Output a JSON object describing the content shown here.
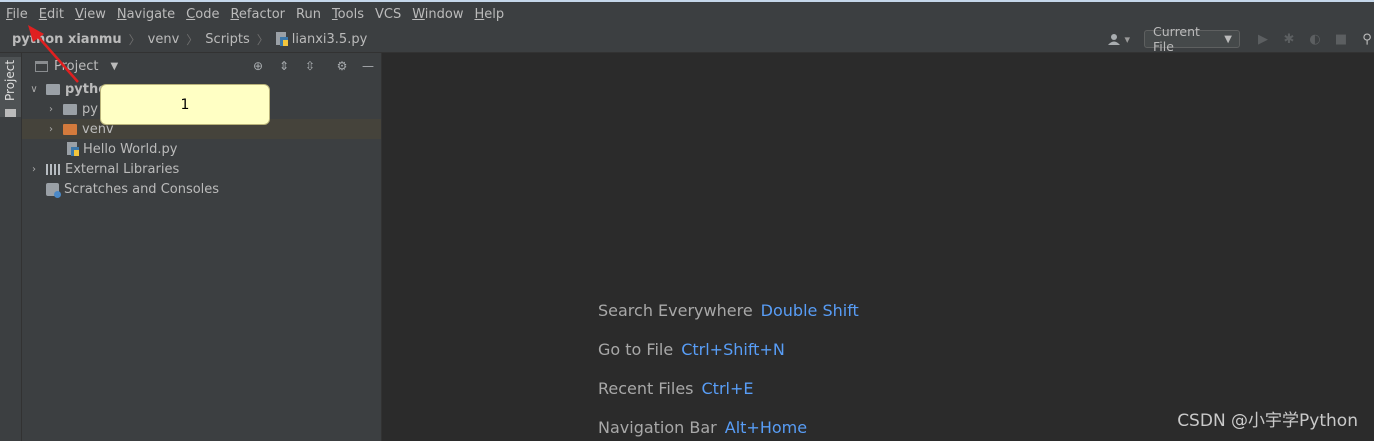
{
  "menu": [
    {
      "label": "File",
      "mnemonic": "F",
      "rest": "ile"
    },
    {
      "label": "Edit",
      "mnemonic": "E",
      "rest": "dit"
    },
    {
      "label": "View",
      "mnemonic": "V",
      "rest": "iew"
    },
    {
      "label": "Navigate",
      "mnemonic": "N",
      "rest": "avigate"
    },
    {
      "label": "Code",
      "mnemonic": "C",
      "rest": "ode"
    },
    {
      "label": "Refactor",
      "mnemonic": "R",
      "rest": "efactor"
    },
    {
      "label": "Run",
      "mnemonic": "",
      "rest": "Run"
    },
    {
      "label": "Tools",
      "mnemonic": "T",
      "rest": "ools"
    },
    {
      "label": "VCS",
      "mnemonic": "",
      "rest": "VCS"
    },
    {
      "label": "Window",
      "mnemonic": "W",
      "rest": "indow"
    },
    {
      "label": "Help",
      "mnemonic": "H",
      "rest": "elp"
    }
  ],
  "breadcrumb": {
    "project": "python xianmu",
    "folder1": "venv",
    "folder2": "Scripts",
    "file": "lianxi3.5.py"
  },
  "toolbar": {
    "run_config": "Current File"
  },
  "stripe": {
    "project_tab": "Project"
  },
  "panel": {
    "title": "Project",
    "tree": {
      "root": "pytho",
      "child1": "py",
      "venv": "venv",
      "hello": "Hello World.py",
      "libs": "External Libraries",
      "scratches": "Scratches and Consoles"
    }
  },
  "callout": {
    "text": "1"
  },
  "editor": {
    "hints": [
      {
        "label": "Search Everywhere",
        "shortcut": "Double Shift"
      },
      {
        "label": "Go to File",
        "shortcut": "Ctrl+Shift+N"
      },
      {
        "label": "Recent Files",
        "shortcut": "Ctrl+E"
      },
      {
        "label": "Navigation Bar",
        "shortcut": "Alt+Home"
      }
    ]
  },
  "watermark": "CSDN @小宇学Python",
  "colors": {
    "background": "#2b2b2b",
    "panel": "#3c3f41",
    "shortcut": "#589df6",
    "callout": "#ffffc4",
    "arrow": "#e02020"
  }
}
